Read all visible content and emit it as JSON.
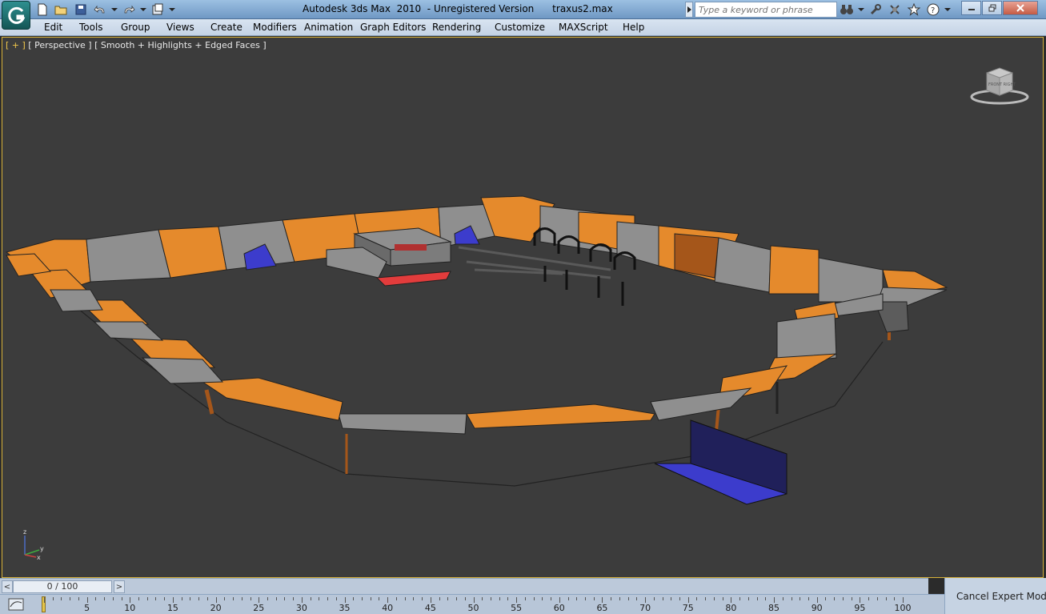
{
  "window": {
    "title": "Autodesk 3ds Max  2010  - Unregistered Version      traxus2.max"
  },
  "search": {
    "placeholder": "Type a keyword or phrase"
  },
  "menu": {
    "items": [
      "Edit",
      "Tools",
      "Group",
      "Views",
      "Create",
      "Modifiers",
      "Animation",
      "Graph Editors",
      "Rendering",
      "Customize",
      "MAXScript",
      "Help"
    ]
  },
  "viewport": {
    "label_plus": "[ + ]",
    "label_rest": " [ Perspective ] [ Smooth + Highlights + Edged Faces ]",
    "viewcube_text": "FRONT  RIGHT"
  },
  "axes": {
    "x": "x",
    "y": "y",
    "z": "z"
  },
  "timeline": {
    "prev": "<",
    "next": ">",
    "position": "0 / 100",
    "frame_labels": [
      "0",
      "5",
      "10",
      "15",
      "20",
      "25",
      "30",
      "35",
      "40",
      "45",
      "50",
      "55",
      "60",
      "65",
      "70",
      "75",
      "80",
      "85",
      "90",
      "95",
      "100"
    ]
  },
  "status": {
    "cancel_expert": "Cancel Expert Mode"
  },
  "colors": {
    "orange": "#e58a2c",
    "dark_orange": "#a5561a",
    "gray": "#8f8f8f",
    "blue": "#3c3ccc",
    "viewport_bg": "#3c3c3c",
    "active_border": "#d8b23a"
  }
}
